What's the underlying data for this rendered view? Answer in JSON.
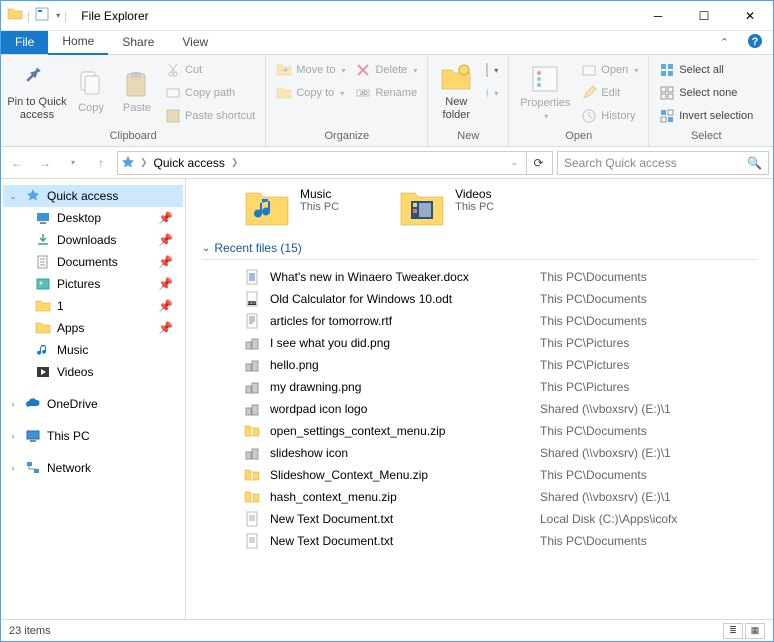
{
  "window": {
    "title": "File Explorer"
  },
  "tabs": {
    "file": "File",
    "home": "Home",
    "share": "Share",
    "view": "View"
  },
  "ribbon": {
    "clipboard": {
      "label": "Clipboard",
      "pin": "Pin to Quick access",
      "copy": "Copy",
      "paste": "Paste",
      "cut": "Cut",
      "copypath": "Copy path",
      "pasteshortcut": "Paste shortcut"
    },
    "organize": {
      "label": "Organize",
      "moveto": "Move to",
      "copyto": "Copy to",
      "delete": "Delete",
      "rename": "Rename"
    },
    "new": {
      "label": "New",
      "newfolder": "New folder"
    },
    "open": {
      "label": "Open",
      "properties": "Properties",
      "open": "Open",
      "edit": "Edit",
      "history": "History"
    },
    "select": {
      "label": "Select",
      "all": "Select all",
      "none": "Select none",
      "invert": "Invert selection"
    }
  },
  "addressbar": {
    "root": "Quick access"
  },
  "search": {
    "placeholder": "Search Quick access"
  },
  "nav": {
    "quick": "Quick access",
    "items": [
      {
        "label": "Desktop",
        "pin": true
      },
      {
        "label": "Downloads",
        "pin": true
      },
      {
        "label": "Documents",
        "pin": true
      },
      {
        "label": "Pictures",
        "pin": true
      },
      {
        "label": "1",
        "pin": true
      },
      {
        "label": "Apps",
        "pin": true
      },
      {
        "label": "Music",
        "pin": false
      },
      {
        "label": "Videos",
        "pin": false
      }
    ],
    "onedrive": "OneDrive",
    "thispc": "This PC",
    "network": "Network"
  },
  "content": {
    "tiles": [
      {
        "name": "Music",
        "loc": "This PC"
      },
      {
        "name": "Videos",
        "loc": "This PC"
      }
    ],
    "section": "Recent files (15)",
    "files": [
      {
        "name": "What's new in Winaero Tweaker.docx",
        "loc": "This PC\\Documents",
        "icon": "docx"
      },
      {
        "name": "Old Calculator for Windows 10.odt",
        "loc": "This PC\\Documents",
        "icon": "odt"
      },
      {
        "name": "articles for tomorrow.rtf",
        "loc": "This PC\\Documents",
        "icon": "rtf"
      },
      {
        "name": "I see what you did.png",
        "loc": "This PC\\Pictures",
        "icon": "png"
      },
      {
        "name": "hello.png",
        "loc": "This PC\\Pictures",
        "icon": "png"
      },
      {
        "name": "my drawning.png",
        "loc": "This PC\\Pictures",
        "icon": "png"
      },
      {
        "name": "wordpad icon logo",
        "loc": "Shared (\\\\vboxsrv) (E:)\\1",
        "icon": "png"
      },
      {
        "name": "open_settings_context_menu.zip",
        "loc": "This PC\\Documents",
        "icon": "zip"
      },
      {
        "name": "slideshow icon",
        "loc": "Shared (\\\\vboxsrv) (E:)\\1",
        "icon": "png"
      },
      {
        "name": "Slideshow_Context_Menu.zip",
        "loc": "This PC\\Documents",
        "icon": "zip"
      },
      {
        "name": "hash_context_menu.zip",
        "loc": "Shared (\\\\vboxsrv) (E:)\\1",
        "icon": "zip"
      },
      {
        "name": "New Text Document.txt",
        "loc": "Local Disk (C:)\\Apps\\icofx",
        "icon": "txt"
      },
      {
        "name": "New Text Document.txt",
        "loc": "This PC\\Documents",
        "icon": "txt"
      }
    ]
  },
  "status": {
    "count": "23 items"
  }
}
